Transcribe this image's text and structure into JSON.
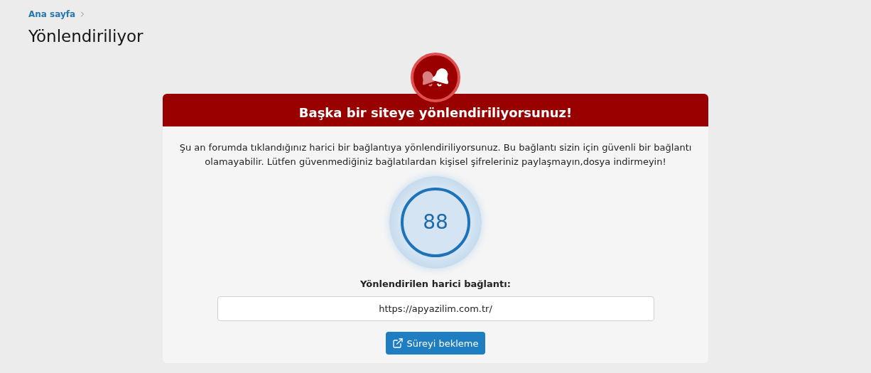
{
  "breadcrumb": [
    {
      "label": "Ana sayfa"
    }
  ],
  "page_title": "Yönlendiriliyor",
  "card": {
    "title": "Başka bir siteye yönlendiriliyorsunuz!",
    "message": "Şu an forumda tıklandığınız harici bir bağlantıya yönlendiriliyorsunuz. Bu bağlantı sizin için güvenli bir bağlantı olamayabilir. Lütfen güvenmediğiniz bağlatılardan kişisel şifreleriniz paylaşmayın,dosya indirmeyin!",
    "countdown": "88",
    "link_label": "Yönlendirilen harici bağlantı:",
    "link_value": "https://apyazilim.com.tr/",
    "button": "Süreyi bekleme"
  }
}
